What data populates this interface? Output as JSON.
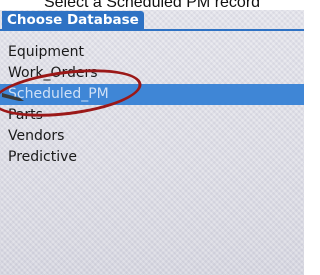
{
  "caption": "Select a Scheduled PM record",
  "window": {
    "title": "Choose Database"
  },
  "databases": [
    {
      "label": "Equipment",
      "selected": false
    },
    {
      "label": "Work_Orders",
      "selected": false
    },
    {
      "label": "Scheduled_PM",
      "selected": true
    },
    {
      "label": "Parts",
      "selected": false
    },
    {
      "label": "Vendors",
      "selected": false
    },
    {
      "label": "Predictive",
      "selected": false
    }
  ],
  "colors": {
    "accent": "#2e72c4",
    "selection": "#3f86d6",
    "annotation": "#9b1818"
  }
}
